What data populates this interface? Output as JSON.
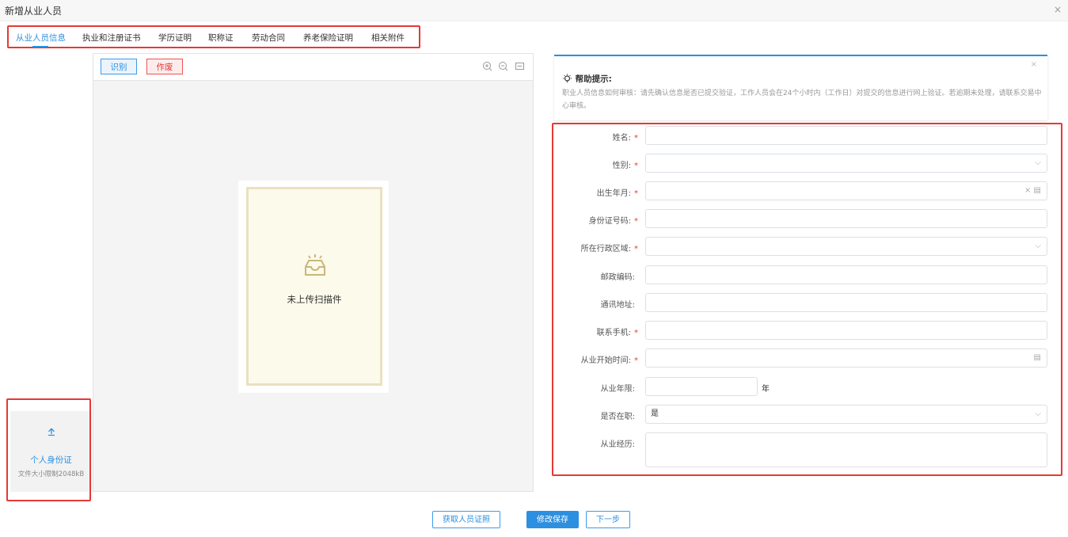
{
  "window": {
    "title": "新增从业人员",
    "close": "×"
  },
  "tabs": [
    "从业人员信息",
    "执业和注册证书",
    "学历证明",
    "职称证",
    "劳动合同",
    "养老保险证明",
    "相关附件"
  ],
  "upload": {
    "icon": "upload-arrow-icon",
    "label": "个人身份证",
    "hint": "文件大小限制2048kB"
  },
  "viewer": {
    "identify_label": "识别",
    "void_label": "作废",
    "empty_text": "未上传扫描件",
    "icons": [
      "zoom-in-icon",
      "zoom-out-icon",
      "fit-icon"
    ]
  },
  "help": {
    "title": "帮助提示:",
    "text": "职业人员信息如何审核：请先确认信息是否已提交验证，工作人员会在24个小时内（工作日）对提交的信息进行网上验证。若逾期未处理，请联系交易中心审核。",
    "close": "×"
  },
  "form": {
    "fields": [
      {
        "label": "姓名:",
        "required": "*",
        "value": ""
      },
      {
        "label": "性别:",
        "required": "*",
        "value": "",
        "suffix": "⌵"
      },
      {
        "label": "出生年月:",
        "required": "*",
        "value": "",
        "suffix": "×  ▤"
      },
      {
        "label": "身份证号码:",
        "required": "*",
        "value": ""
      },
      {
        "label": "所在行政区域:",
        "required": "*",
        "value": "",
        "suffix": "⌵"
      },
      {
        "label": "邮政编码:",
        "required": "",
        "value": ""
      },
      {
        "label": "通讯地址:",
        "required": "",
        "value": ""
      },
      {
        "label": "联系手机:",
        "required": "*",
        "value": ""
      },
      {
        "label": "从业开始时间:",
        "required": "*",
        "value": "",
        "suffix": "▤"
      },
      {
        "label": "从业年限:",
        "required": "",
        "value": "",
        "unit": "年"
      },
      {
        "label": "是否在职:",
        "required": "",
        "value": "是",
        "suffix": "⌵"
      },
      {
        "label": "从业经历:",
        "required": "",
        "value": ""
      }
    ]
  },
  "footer": {
    "get_cert_label": "获取人员证照",
    "save_label": "修改保存",
    "next_label": "下一步"
  },
  "colors": {
    "accent": "#2c8fe0",
    "danger": "#e53935",
    "doc_bg": "#fcfaeb"
  }
}
